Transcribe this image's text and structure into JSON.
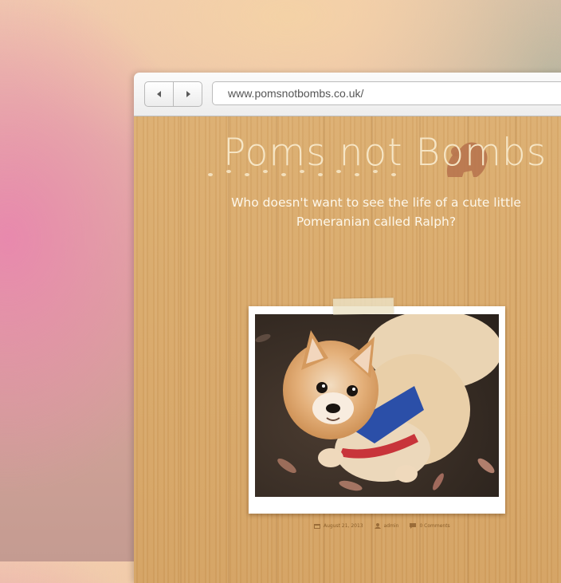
{
  "browser": {
    "url": "www.pomsnotbombs.co.uk/",
    "back_icon": "chevron-left-icon",
    "forward_icon": "chevron-right-icon"
  },
  "site": {
    "title": "Poms not Bombs",
    "tagline": "Who doesn't want to see the life of a cute little Pomeranian called Ralph?",
    "accent_color": "#f6e6c6",
    "silhouette_color": "#b9764f"
  },
  "post": {
    "date": "August 21, 2013",
    "author": "admin",
    "comments": "0 Comments",
    "date_icon": "calendar-icon",
    "author_icon": "user-icon",
    "comments_icon": "comment-icon"
  }
}
